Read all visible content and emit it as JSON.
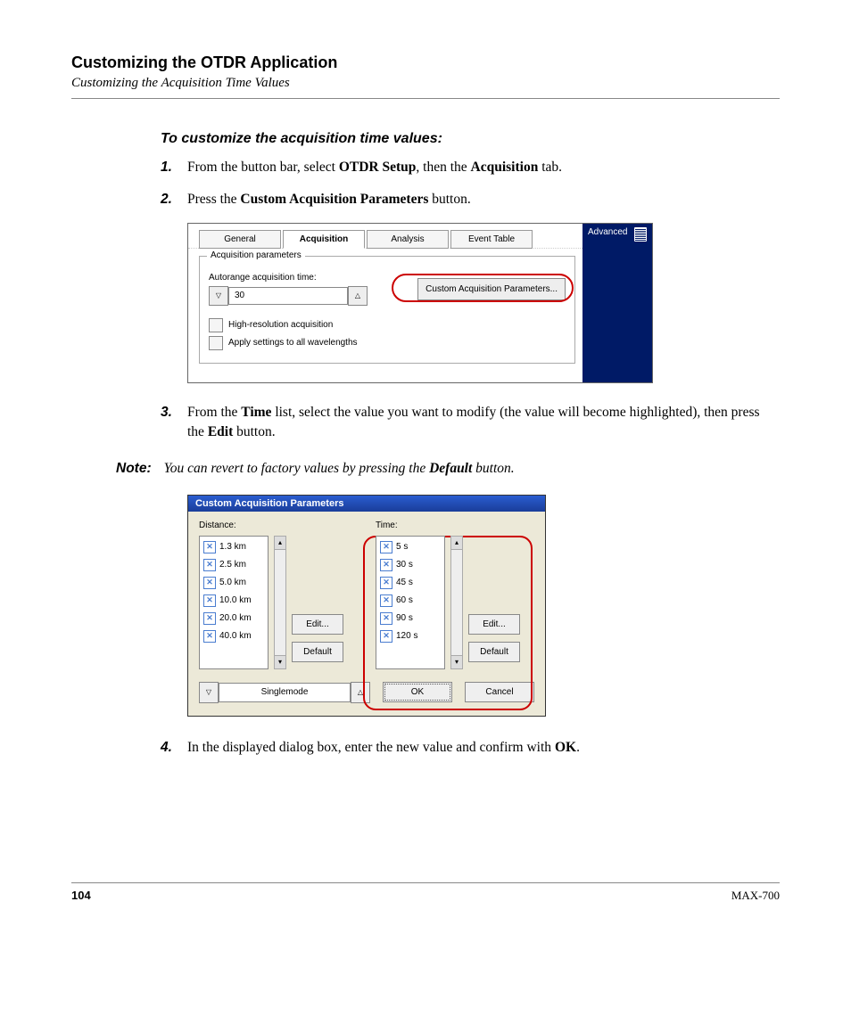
{
  "header": {
    "chapter": "Customizing the OTDR Application",
    "section": "Customizing the Acquisition Time Values"
  },
  "subhead": "To customize the acquisition time values:",
  "steps": {
    "s1": {
      "num": "1.",
      "pre": "From the button bar, select ",
      "b1": "OTDR Setup",
      "mid": ", then the ",
      "b2": "Acquisition",
      "post": " tab."
    },
    "s2": {
      "num": "2.",
      "pre": "Press the ",
      "b1": "Custom Acquisition Parameters",
      "post": " button."
    },
    "s3": {
      "num": "3.",
      "pre": "From the ",
      "b1": "Time",
      "mid": " list, select the value you want to modify (the value will become highlighted), then press the ",
      "b2": "Edit",
      "post": " button."
    },
    "s4": {
      "num": "4.",
      "pre": "In the displayed dialog box, enter the new value and confirm with ",
      "b1": "OK",
      "post": "."
    }
  },
  "note": {
    "label": "Note:",
    "pre": "You can revert to factory values by pressing the ",
    "bold": "Default",
    "post": " button."
  },
  "shot1": {
    "tabs": {
      "general": "General",
      "acquisition": "Acquisition",
      "analysis": "Analysis",
      "event": "Event Table"
    },
    "side": "Advanced",
    "fieldset_legend": "Acquisition parameters",
    "autorange_label": "Autorange acquisition time:",
    "autorange_value": "30",
    "cap_button": "Custom Acquisition Parameters...",
    "check1": "High-resolution acquisition",
    "check2": "Apply settings to all wavelengths"
  },
  "shot2": {
    "title": "Custom Acquisition Parameters",
    "distance_label": "Distance:",
    "time_label": "Time:",
    "distance_items": [
      "1.3 km",
      "2.5 km",
      "5.0 km",
      "10.0 km",
      "20.0 km",
      "40.0 km"
    ],
    "time_items": [
      "5 s",
      "30 s",
      "45 s",
      "60 s",
      "90 s",
      "120 s"
    ],
    "edit_btn": "Edit...",
    "default_btn": "Default",
    "mode": "Singlemode",
    "ok": "OK",
    "cancel": "Cancel"
  },
  "footer": {
    "page": "104",
    "model": "MAX-700"
  }
}
